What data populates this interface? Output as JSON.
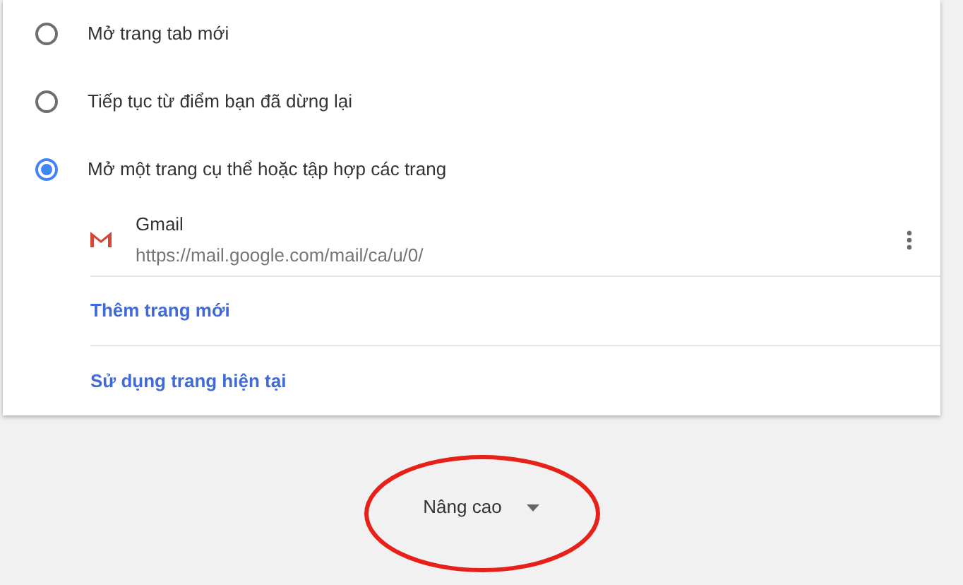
{
  "startup_options": [
    {
      "label": "Mở trang tab mới",
      "selected": false
    },
    {
      "label": "Tiếp tục từ điểm bạn đã dừng lại",
      "selected": false
    },
    {
      "label": "Mở một trang cụ thể hoặc tập hợp các trang",
      "selected": true
    }
  ],
  "pages": [
    {
      "title": "Gmail",
      "url": "https://mail.google.com/mail/ca/u/0/"
    }
  ],
  "links": [
    "Thêm trang mới",
    "Sử dụng trang hiện tại"
  ],
  "advanced": {
    "label": "Nâng cao",
    "expanded": false
  }
}
